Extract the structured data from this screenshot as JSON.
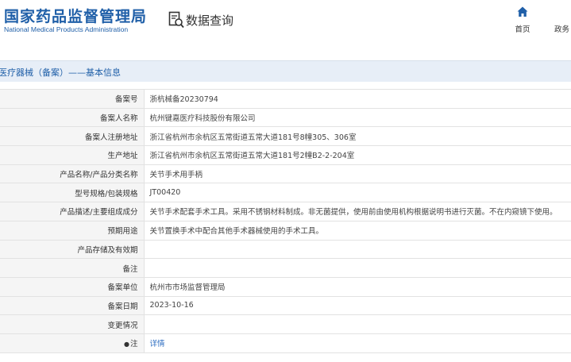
{
  "header": {
    "logo_cn": "国家药品监督管理局",
    "logo_en": "National Medical Products Administration",
    "query_title": "数据查询",
    "nav_home": "首页",
    "nav_gov": "政务"
  },
  "section": {
    "title": "医疗器械（备案）——基本信息"
  },
  "rows": [
    {
      "key": "备案号",
      "value": "浙杭械备20230794"
    },
    {
      "key": "备案人名称",
      "value": "杭州键嘉医疗科技股份有限公司"
    },
    {
      "key": "备案人注册地址",
      "value": "浙江省杭州市余杭区五常街道五常大道181号8幢305、306室"
    },
    {
      "key": "生产地址",
      "value": "浙江省杭州市余杭区五常街道五常大道181号2幢B2-2-204室"
    },
    {
      "key": "产品名称/产品分类名称",
      "value": "关节手术用手柄"
    },
    {
      "key": "型号规格/包装规格",
      "value": "JT00420"
    },
    {
      "key": "产品描述/主要组成成分",
      "value": "关节手术配套手术工具。采用不锈钢材料制成。非无菌提供，使用前由使用机构根据说明书进行灭菌。不在内窥镜下使用。"
    },
    {
      "key": "预期用途",
      "value": "关节置换手术中配合其他手术器械使用的手术工具。"
    },
    {
      "key": "产品存储及有效期",
      "value": ""
    },
    {
      "key": "备注",
      "value": ""
    },
    {
      "key": "备案单位",
      "value": "杭州市市场监督管理局"
    },
    {
      "key": "备案日期",
      "value": "2023-10-16"
    },
    {
      "key": "变更情况",
      "value": ""
    },
    {
      "key": "注",
      "value": "详情"
    }
  ],
  "colors": {
    "brand_blue": "#1f5fa8",
    "section_bg": "#e7eef7",
    "key_bg": "#f5f5f5",
    "link": "#2a6bc0"
  },
  "icons": {
    "query": "search-document-icon",
    "home": "home-icon",
    "note": "pin-icon"
  }
}
